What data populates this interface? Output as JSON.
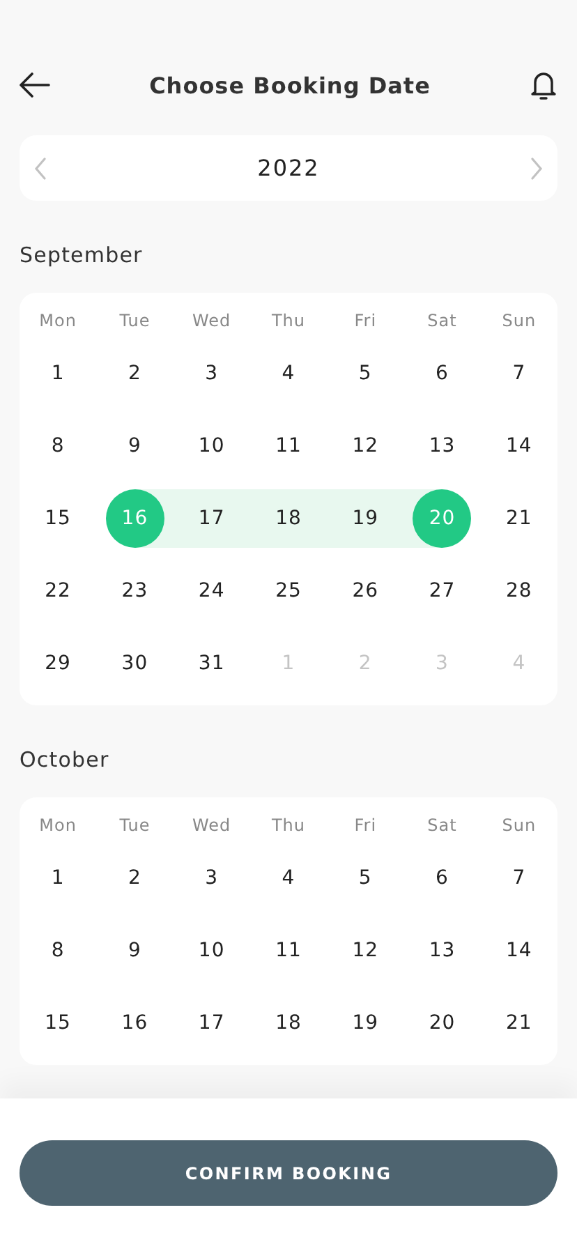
{
  "header": {
    "title": "Choose Booking Date"
  },
  "year_picker": {
    "year": "2022"
  },
  "months": [
    {
      "name": "September",
      "weekdays": [
        "Mon",
        "Tue",
        "Wed",
        "Thu",
        "Fri",
        "Sat",
        "Sun"
      ],
      "weeks": [
        [
          {
            "day": "1",
            "other_month": false,
            "selected": false,
            "in_range": false
          },
          {
            "day": "2",
            "other_month": false,
            "selected": false,
            "in_range": false
          },
          {
            "day": "3",
            "other_month": false,
            "selected": false,
            "in_range": false
          },
          {
            "day": "4",
            "other_month": false,
            "selected": false,
            "in_range": false
          },
          {
            "day": "5",
            "other_month": false,
            "selected": false,
            "in_range": false
          },
          {
            "day": "6",
            "other_month": false,
            "selected": false,
            "in_range": false
          },
          {
            "day": "7",
            "other_month": false,
            "selected": false,
            "in_range": false
          }
        ],
        [
          {
            "day": "8",
            "other_month": false,
            "selected": false,
            "in_range": false
          },
          {
            "day": "9",
            "other_month": false,
            "selected": false,
            "in_range": false
          },
          {
            "day": "10",
            "other_month": false,
            "selected": false,
            "in_range": false
          },
          {
            "day": "11",
            "other_month": false,
            "selected": false,
            "in_range": false
          },
          {
            "day": "12",
            "other_month": false,
            "selected": false,
            "in_range": false
          },
          {
            "day": "13",
            "other_month": false,
            "selected": false,
            "in_range": false
          },
          {
            "day": "14",
            "other_month": false,
            "selected": false,
            "in_range": false
          }
        ],
        [
          {
            "day": "15",
            "other_month": false,
            "selected": false,
            "in_range": false
          },
          {
            "day": "16",
            "other_month": false,
            "selected": true,
            "in_range": false
          },
          {
            "day": "17",
            "other_month": false,
            "selected": false,
            "in_range": true
          },
          {
            "day": "18",
            "other_month": false,
            "selected": false,
            "in_range": true
          },
          {
            "day": "19",
            "other_month": false,
            "selected": false,
            "in_range": true
          },
          {
            "day": "20",
            "other_month": false,
            "selected": true,
            "in_range": false
          },
          {
            "day": "21",
            "other_month": false,
            "selected": false,
            "in_range": false
          }
        ],
        [
          {
            "day": "22",
            "other_month": false,
            "selected": false,
            "in_range": false
          },
          {
            "day": "23",
            "other_month": false,
            "selected": false,
            "in_range": false
          },
          {
            "day": "24",
            "other_month": false,
            "selected": false,
            "in_range": false
          },
          {
            "day": "25",
            "other_month": false,
            "selected": false,
            "in_range": false
          },
          {
            "day": "26",
            "other_month": false,
            "selected": false,
            "in_range": false
          },
          {
            "day": "27",
            "other_month": false,
            "selected": false,
            "in_range": false
          },
          {
            "day": "28",
            "other_month": false,
            "selected": false,
            "in_range": false
          }
        ],
        [
          {
            "day": "29",
            "other_month": false,
            "selected": false,
            "in_range": false
          },
          {
            "day": "30",
            "other_month": false,
            "selected": false,
            "in_range": false
          },
          {
            "day": "31",
            "other_month": false,
            "selected": false,
            "in_range": false
          },
          {
            "day": "1",
            "other_month": true,
            "selected": false,
            "in_range": false
          },
          {
            "day": "2",
            "other_month": true,
            "selected": false,
            "in_range": false
          },
          {
            "day": "3",
            "other_month": true,
            "selected": false,
            "in_range": false
          },
          {
            "day": "4",
            "other_month": true,
            "selected": false,
            "in_range": false
          }
        ]
      ]
    },
    {
      "name": "October",
      "weekdays": [
        "Mon",
        "Tue",
        "Wed",
        "Thu",
        "Fri",
        "Sat",
        "Sun"
      ],
      "weeks": [
        [
          {
            "day": "1",
            "other_month": false,
            "selected": false,
            "in_range": false
          },
          {
            "day": "2",
            "other_month": false,
            "selected": false,
            "in_range": false
          },
          {
            "day": "3",
            "other_month": false,
            "selected": false,
            "in_range": false
          },
          {
            "day": "4",
            "other_month": false,
            "selected": false,
            "in_range": false
          },
          {
            "day": "5",
            "other_month": false,
            "selected": false,
            "in_range": false
          },
          {
            "day": "6",
            "other_month": false,
            "selected": false,
            "in_range": false
          },
          {
            "day": "7",
            "other_month": false,
            "selected": false,
            "in_range": false
          }
        ],
        [
          {
            "day": "8",
            "other_month": false,
            "selected": false,
            "in_range": false
          },
          {
            "day": "9",
            "other_month": false,
            "selected": false,
            "in_range": false
          },
          {
            "day": "10",
            "other_month": false,
            "selected": false,
            "in_range": false
          },
          {
            "day": "11",
            "other_month": false,
            "selected": false,
            "in_range": false
          },
          {
            "day": "12",
            "other_month": false,
            "selected": false,
            "in_range": false
          },
          {
            "day": "13",
            "other_month": false,
            "selected": false,
            "in_range": false
          },
          {
            "day": "14",
            "other_month": false,
            "selected": false,
            "in_range": false
          }
        ],
        [
          {
            "day": "15",
            "other_month": false,
            "selected": false,
            "in_range": false
          },
          {
            "day": "16",
            "other_month": false,
            "selected": false,
            "in_range": false
          },
          {
            "day": "17",
            "other_month": false,
            "selected": false,
            "in_range": false
          },
          {
            "day": "18",
            "other_month": false,
            "selected": false,
            "in_range": false
          },
          {
            "day": "19",
            "other_month": false,
            "selected": false,
            "in_range": false
          },
          {
            "day": "20",
            "other_month": false,
            "selected": false,
            "in_range": false
          },
          {
            "day": "21",
            "other_month": false,
            "selected": false,
            "in_range": false
          }
        ]
      ]
    }
  ],
  "footer": {
    "button": "CONFIRM BOOKING"
  }
}
